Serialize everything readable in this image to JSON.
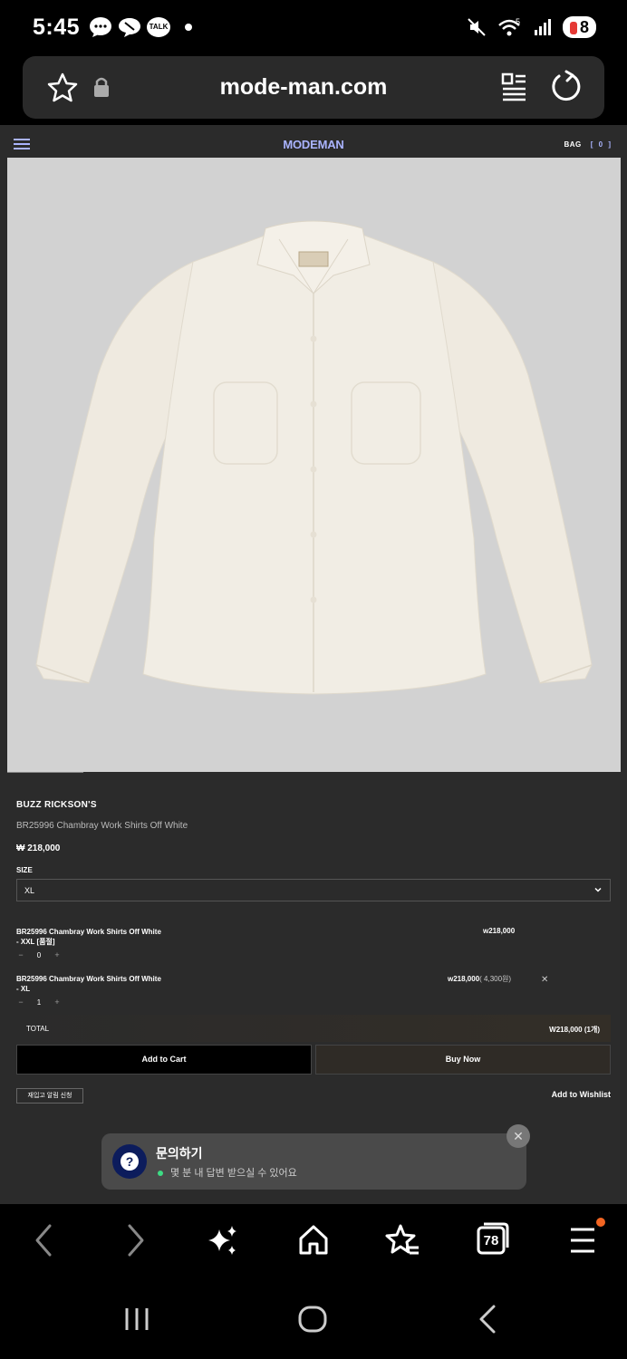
{
  "status_bar": {
    "time": "5:45",
    "talk_label": "TALK",
    "battery": "8"
  },
  "browser": {
    "url": "mode-man.com",
    "tabs_count": "78"
  },
  "site": {
    "logo": "MODEMAN",
    "bag_label": "BAG",
    "bag_count": "[ 0 ]"
  },
  "product": {
    "brand": "BUZZ RICKSON'S",
    "name": "BR25996 Chambray Work Shirts Off White",
    "price": "₩ 218,000",
    "size_label": "SIZE",
    "size_selected": "XL"
  },
  "options": [
    {
      "name": "BR25996 Chambray Work Shirts Off White",
      "variant": "- XXL [품절]",
      "qty": "0",
      "price": "w218,000",
      "price_sub": ""
    },
    {
      "name": "BR25996 Chambray Work Shirts Off White",
      "variant": "- XL",
      "qty": "1",
      "price": "w218,000",
      "price_sub": "( 4,300원)"
    }
  ],
  "total": {
    "label": "TOTAL",
    "value": "W218,000 (1개)"
  },
  "actions": {
    "add_to_cart": "Add to Cart",
    "buy_now": "Buy Now",
    "restock": "재입고 알림 신청",
    "wishlist": "Add to Wishlist"
  },
  "chat": {
    "title": "문의하기",
    "subtitle": "몇 분 내 답변 받으실 수 있어요"
  },
  "colors": {
    "accent": "#aab4ff",
    "page_bg": "#2b2b2b",
    "image_bg": "#d2d2d2",
    "notification": "#f26522",
    "online": "#3ddc84"
  }
}
